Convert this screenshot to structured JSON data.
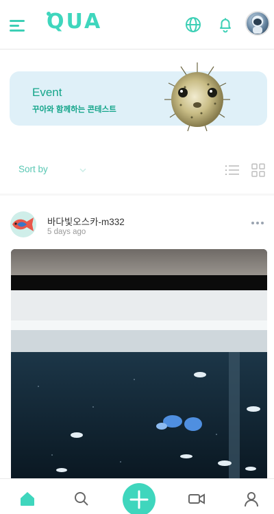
{
  "header": {
    "logo": "QUA",
    "icons": [
      "menu-icon",
      "globe-icon",
      "bell-icon",
      "avatar"
    ],
    "accent": "#3fd6bd"
  },
  "event": {
    "title": "Event",
    "subtitle": "꾸아와 함께하는 콘테스트",
    "background": "#dff0f8"
  },
  "sort": {
    "label": "Sort by"
  },
  "post": {
    "username": "바다빛오스카-m332",
    "time": "5 days ago"
  },
  "bottom_nav": {
    "items": [
      "home-icon",
      "search-icon",
      "add-icon",
      "video-icon",
      "profile-icon"
    ],
    "active": "home-icon"
  }
}
